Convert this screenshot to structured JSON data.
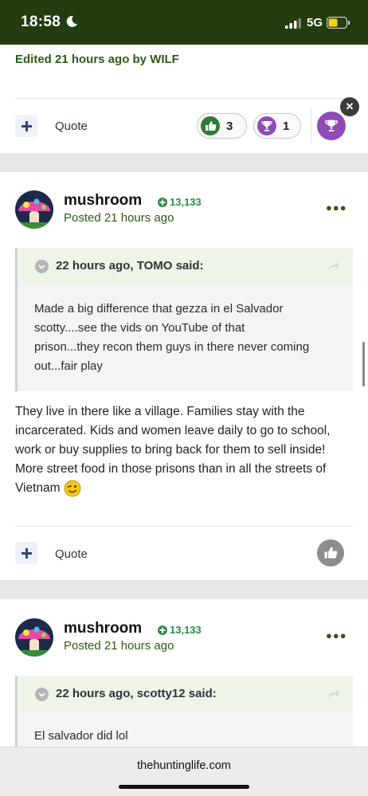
{
  "status_bar": {
    "time": "18:58",
    "network": "5G"
  },
  "post1": {
    "edited_note": "Edited 21 hours ago by WILF",
    "quote_label": "Quote",
    "reactions": [
      {
        "icon": "thumbs-up",
        "count": "3"
      },
      {
        "icon": "trophy",
        "count": "1"
      }
    ]
  },
  "post2": {
    "author": "mushroom",
    "reputation": "13,133",
    "posted": "Posted 21 hours ago",
    "quote": {
      "citation": "22 hours ago, TOMO said:",
      "lines": [
        "Made a big difference that gezza in el Salvador",
        "scotty....see the vids on YouTube of that",
        "prison...they recon them guys in there never coming",
        "out...fair play"
      ]
    },
    "body_lines": [
      "They live in there like a village. Families stay with the",
      "incarcerated. Kids and women leave daily to go to school,",
      "work or buy supplies to bring back for them to sell inside!",
      "More street food in those prisons than in all the streets of",
      "Vietnam"
    ],
    "quote_label": "Quote"
  },
  "post3": {
    "author": "mushroom",
    "reputation": "13,133",
    "posted": "Posted 21 hours ago",
    "quote": {
      "citation": "22 hours ago, scotty12 said:",
      "lines": [
        "El salvador did lol"
      ]
    }
  },
  "browser": {
    "url": "thehuntinglife.com"
  },
  "colors": {
    "status_bar": "#223d10",
    "accent_green": "#2e5a14",
    "rep_green": "#2e8b47",
    "trophy_purple": "#8e4bb6"
  }
}
